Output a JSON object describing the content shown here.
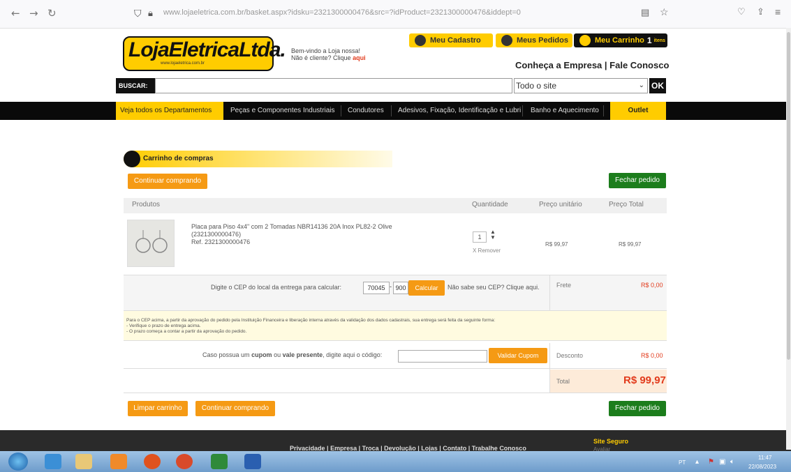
{
  "browser": {
    "url": "www.lojaeletrica.com.br/basket.aspx?idsku=2321300000476&src=?idProduct=2321300000476&iddept=0",
    "url_domain": "lojaeletrica.com.br"
  },
  "header": {
    "logo_text": "LojaEletricaLtda.",
    "logo_sub": "www.lojaeletrica.com.br",
    "welcome_line1": "Bem-vindo a Loja nossa!",
    "welcome_line2": "Não é cliente? Clique",
    "welcome_link": "aqui",
    "meu_cadastro": "Meu Cadastro",
    "meus_pedidos": "Meus Pedidos",
    "meu_carrinho": "Meu Carrinho",
    "cart_count": "1",
    "cart_itens": "itens",
    "conheca": "Conheça a Empresa",
    "fale": "Fale Conosco",
    "search_label": "BUSCAR:",
    "search_scope": "Todo o site",
    "search_ok": "OK"
  },
  "departments": [
    "Veja todos os Departamentos",
    "Peças e Componentes Industriais",
    "Condutores",
    "Adesivos, Fixação, Identificação e Lubri",
    "Banho e Aquecimento",
    "Outlet"
  ],
  "cart": {
    "title": "Carrinho de compras",
    "continue_label": "Continuar comprando",
    "close_order_label": "Fechar pedido",
    "columns": {
      "products": "Produtos",
      "quantity": "Quantidade",
      "unit_price": "Preço unitário",
      "total_price": "Preço Total"
    },
    "item": {
      "name": "Placa para Piso 4x4\" com 2 Tomadas NBR14136 20A Inox PL82-2 Olive",
      "code": "(2321300000476)",
      "ref": "Ref. 2321300000476",
      "qty": "1",
      "remove": "X Remover",
      "unit_price": "R$ 99,97",
      "total_price": "R$ 99,97"
    },
    "cep": {
      "prompt": "Digite o CEP do local da entrega para calcular:",
      "cep1": "70045",
      "cep2": "900",
      "calc": "Calcular",
      "help": "Não sabe seu CEP? Clique aqui.",
      "frete_label": "Frete",
      "frete_value": "R$ 0,00"
    },
    "notice": [
      "Para o CEP acima, a partir da aprovação do pedido pela Instituição Financeira e liberação interna através da validação dos dados cadastrais, sua entrega será feita da seguinte forma:",
      "- Verifique o prazo de entrega acima.",
      "- O prazo começa a contar a partir da aprovação do pedido."
    ],
    "coupon": {
      "prompt_pre": "Caso possua um",
      "prompt_bold1": "cupom",
      "prompt_mid": "ou",
      "prompt_bold2": "vale presente",
      "prompt_post": ", digite aqui o código:",
      "button": "Validar Cupom",
      "discount_label": "Desconto",
      "discount_value": "R$ 0,00"
    },
    "total_label": "Total",
    "total_value": "R$ 99,97",
    "clear_label": "Limpar carrinho"
  },
  "footer": {
    "links": [
      "Privacidade",
      "Empresa",
      "Troca",
      "Devolução",
      "Lojas",
      "Contato",
      "Trabalhe Conosco"
    ],
    "secure": "Site Seguro",
    "secure_sub": "Avaliar"
  },
  "taskbar": {
    "lang": "PT",
    "time": "11:47",
    "date": "22/08/2023"
  },
  "colors": {
    "yellow": "#ffcc00",
    "orange": "#f59a14",
    "green": "#1c7d1c",
    "red": "#e23b1c"
  }
}
